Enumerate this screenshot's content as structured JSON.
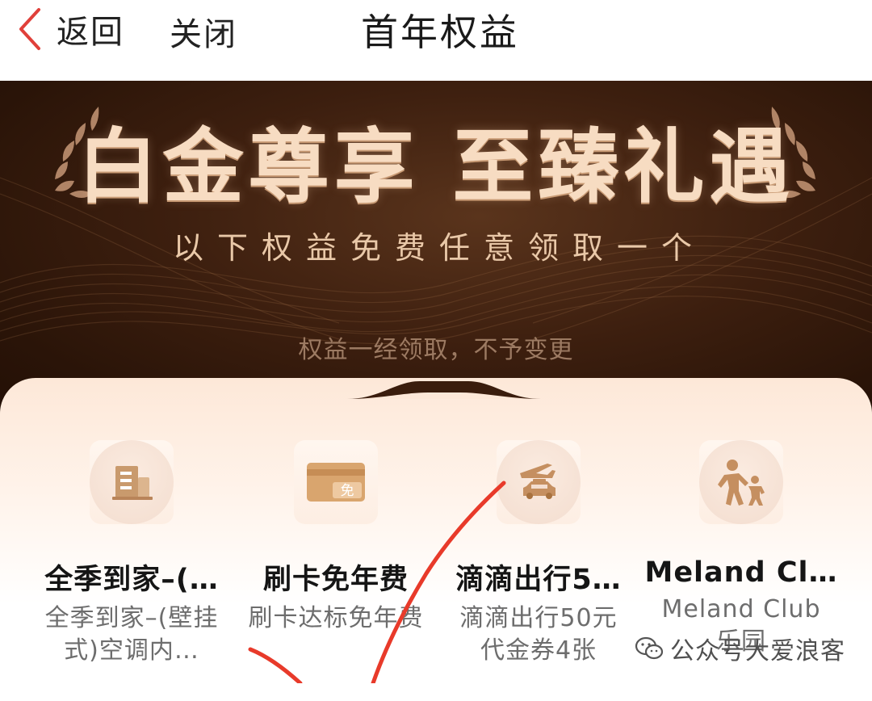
{
  "nav": {
    "back_label": "返回",
    "close_label": "关闭",
    "title": "首年权益"
  },
  "hero": {
    "title": "白金尊享 至臻礼遇",
    "subtitle": "以下权益免费任意领取一个",
    "note": "权益一经领取，不予变更"
  },
  "benefits": [
    {
      "icon": "building-icon",
      "name": "全季到家–(…",
      "desc": "全季到家–(壁挂式)空调内…"
    },
    {
      "icon": "card-free-icon",
      "name": "刷卡免年费",
      "desc": "刷卡达标免年费",
      "badge": "免"
    },
    {
      "icon": "plane-car-icon",
      "name": "滴滴出行5…",
      "desc": "滴滴出行50元代金券4张"
    },
    {
      "icon": "parent-child-icon",
      "name": "Meland Cl…",
      "desc": "Meland Club乐园"
    }
  ],
  "watermark": {
    "icon": "wechat-icon",
    "text": "公众号大爱浪客"
  },
  "colors": {
    "back_arrow": "#e0403a",
    "hero_bg": "#3d1f0f",
    "hero_title": "#f7dcc2",
    "annotation": "#e83a2a"
  }
}
